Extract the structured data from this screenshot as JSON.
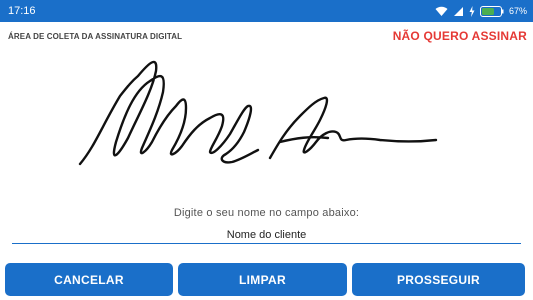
{
  "status_bar": {
    "time": "17:16",
    "battery_percent": "67%",
    "icons": [
      "wifi-icon",
      "signal-icon",
      "charging-icon",
      "battery-icon"
    ],
    "color": "#1a6fc9"
  },
  "header": {
    "title": "ÁREA DE COLETA DA ASSINATURA DIGITAL",
    "decline_label": "NÃO QUERO ASSINAR",
    "decline_color": "#e53935"
  },
  "form": {
    "instruction": "Digite o seu nome no campo abaixo:",
    "name_placeholder": "Nome do cliente",
    "name_value": ""
  },
  "buttons": {
    "cancel_label": "CANCELAR",
    "clear_label": "LIMPAR",
    "next_label": "PROSSEGUIR",
    "color": "#1a6fc9"
  }
}
